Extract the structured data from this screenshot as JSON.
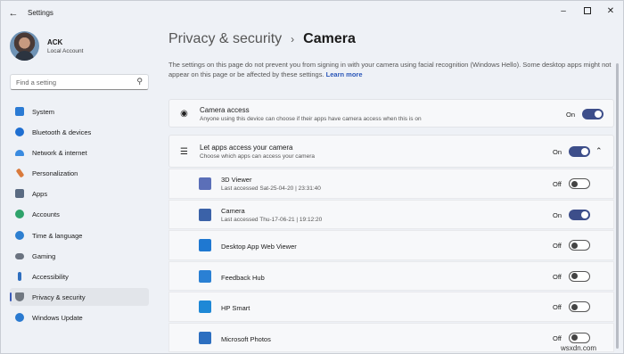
{
  "window": {
    "title": "Settings"
  },
  "profile": {
    "name": "ACK",
    "account": "Local Account"
  },
  "search": {
    "placeholder": "Find a setting"
  },
  "sidebar": {
    "items": [
      {
        "label": "System",
        "icon": "system-icon",
        "color": "#2b7bd4"
      },
      {
        "label": "Bluetooth & devices",
        "icon": "bluetooth-icon",
        "color": "#1f6fd1"
      },
      {
        "label": "Network & internet",
        "icon": "network-icon",
        "color": "#3a8be0"
      },
      {
        "label": "Personalization",
        "icon": "personalization-icon",
        "color": "#d97a3c"
      },
      {
        "label": "Apps",
        "icon": "apps-icon",
        "color": "#5a6b82"
      },
      {
        "label": "Accounts",
        "icon": "accounts-icon",
        "color": "#2fa36b"
      },
      {
        "label": "Time & language",
        "icon": "time-language-icon",
        "color": "#2d7fd0"
      },
      {
        "label": "Gaming",
        "icon": "gaming-icon",
        "color": "#6b7380"
      },
      {
        "label": "Accessibility",
        "icon": "accessibility-icon",
        "color": "#2f6fbf"
      },
      {
        "label": "Privacy & security",
        "icon": "shield-icon",
        "color": "#707780",
        "active": true
      },
      {
        "label": "Windows Update",
        "icon": "windows-update-icon",
        "color": "#2a7ad0"
      }
    ]
  },
  "breadcrumb": {
    "parent": "Privacy & security",
    "separator": "›",
    "current": "Camera"
  },
  "description": {
    "text": "The settings on this page do not prevent you from signing in with your camera using facial recognition (Windows Hello). Some desktop apps might not appear on this page or be affected by these settings.",
    "link": "Learn more"
  },
  "camera_access": {
    "title": "Camera access",
    "subtitle": "Anyone using this device can choose if their apps have camera access when this is on",
    "state": "On"
  },
  "apps_access": {
    "title": "Let apps access your camera",
    "subtitle": "Choose which apps can access your camera",
    "state": "On"
  },
  "apps": [
    {
      "name": "3D Viewer",
      "last_accessed": "Last accessed Sat-25-04-20  |  23:31:40",
      "state": "Off",
      "icon_color": "#5b6fb8"
    },
    {
      "name": "Camera",
      "last_accessed": "Last accessed Thu-17-06-21  |  19:12:20",
      "state": "On",
      "icon_color": "#3b62a8"
    },
    {
      "name": "Desktop App Web Viewer",
      "last_accessed": "",
      "state": "Off",
      "icon_color": "#1f78d1"
    },
    {
      "name": "Feedback Hub",
      "last_accessed": "",
      "state": "Off",
      "icon_color": "#2a80d4"
    },
    {
      "name": "HP Smart",
      "last_accessed": "",
      "state": "Off",
      "icon_color": "#1e88d6"
    },
    {
      "name": "Microsoft Photos",
      "last_accessed": "",
      "state": "Off",
      "icon_color": "#2d6fc0"
    }
  ],
  "watermark": "wsxdn.com",
  "colors": {
    "accent": "#3d4e8a",
    "link": "#2a56b8"
  }
}
